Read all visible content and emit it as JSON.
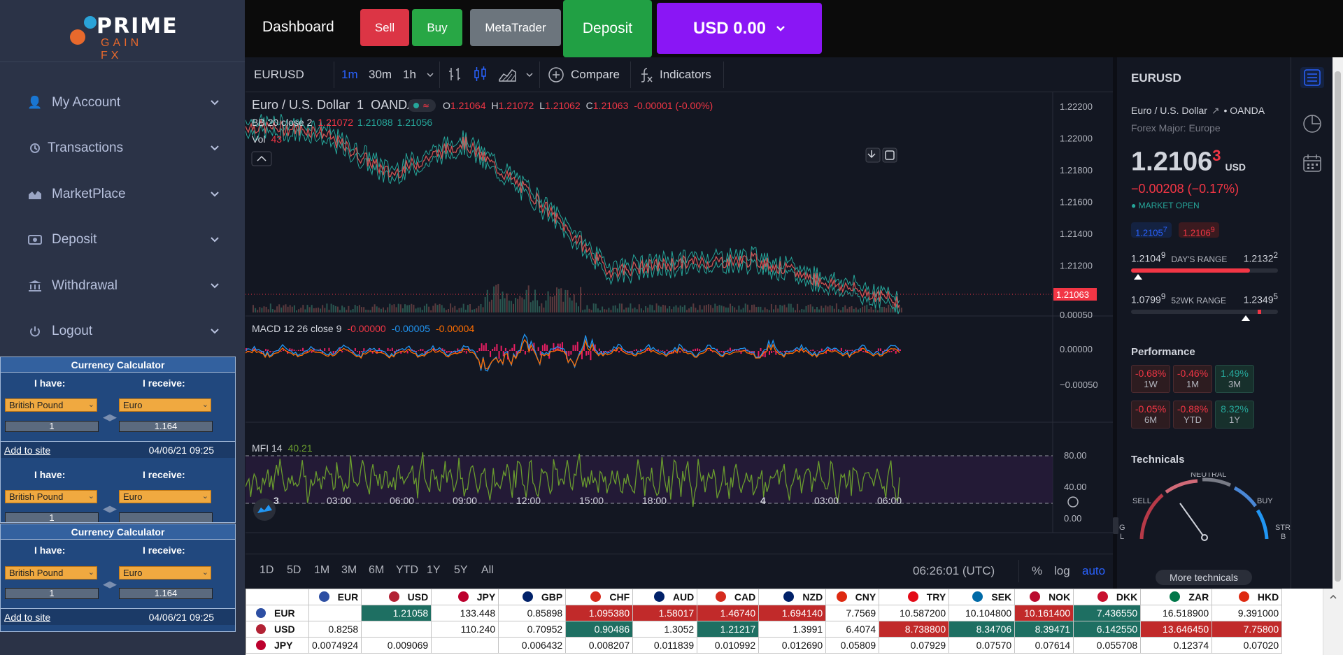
{
  "logo": {
    "line1": "PRIME",
    "line2": "GAIN FX"
  },
  "nav": [
    {
      "label": "My Account",
      "icon": "user-plus-icon"
    },
    {
      "label": "Transactions",
      "icon": "history-icon"
    },
    {
      "label": "MarketPlace",
      "icon": "chart-area-icon"
    },
    {
      "label": "Deposit",
      "icon": "money-bill-icon"
    },
    {
      "label": "Withdrawal",
      "icon": "bank-icon"
    },
    {
      "label": "Logout",
      "icon": "power-icon"
    }
  ],
  "calc": {
    "title": "Currency Calculator",
    "have_label": "I have:",
    "receive_label": "I receive:",
    "from_currency": "British Pound",
    "to_currency": "Euro",
    "amount": "1",
    "result": "1.164",
    "add_link": "Add to site",
    "date": "04/06/21 09:25"
  },
  "topbar": {
    "title": "Dashboard",
    "sell": "Sell",
    "buy": "Buy",
    "metatrader": "MetaTrader",
    "deposit": "Deposit",
    "balance": "USD 0.00"
  },
  "chart": {
    "symbol": "EURUSD",
    "intervals": [
      "1m",
      "30m",
      "1h"
    ],
    "compare": "Compare",
    "indicators": "Indicators",
    "legend_name": "Euro / U.S. Dollar",
    "legend_interval": "1",
    "legend_source": "OANDA",
    "ohlc": {
      "o": "1.21064",
      "h": "1.21072",
      "l": "1.21062",
      "c": "1.21063",
      "chg": "-0.00001 (-0.00%)"
    },
    "bb": {
      "label": "BB 20 close 2",
      "v1": "1.21072",
      "v2": "1.21088",
      "v3": "1.21056"
    },
    "vol": {
      "label": "Vol",
      "value": "43"
    },
    "macd": {
      "label": "MACD 12 26 close 9",
      "v1": "-0.00000",
      "v2": "-0.00005",
      "v3": "-0.00004"
    },
    "mfi": {
      "label": "MFI 14",
      "value": "40.21"
    },
    "price_ticks": [
      "1.22200",
      "1.22000",
      "1.21800",
      "1.21600",
      "1.21400",
      "1.21200",
      "1.21000"
    ],
    "current_price": "1.21063",
    "macd_ticks": [
      "0.00050",
      "0.00000",
      "−0.00050"
    ],
    "mfi_ticks": [
      "80.00",
      "40.00",
      "0.00"
    ],
    "time_ticks": [
      "3",
      "03:00",
      "06:00",
      "09:00",
      "12:00",
      "15:00",
      "18:00",
      "4",
      "03:00",
      "06:00"
    ],
    "ranges": [
      "1D",
      "5D",
      "1M",
      "3M",
      "6M",
      "YTD",
      "1Y",
      "5Y",
      "All"
    ],
    "clock": "06:26:01 (UTC)",
    "pct": "%",
    "log": "log",
    "auto": "auto"
  },
  "chart_data": {
    "type": "line",
    "title": "Euro / U.S. Dollar",
    "x": [
      "3",
      "03:00",
      "06:00",
      "09:00",
      "12:00",
      "15:00",
      "18:00",
      "4",
      "03:00",
      "06:00"
    ],
    "series": [
      {
        "name": "EURUSD",
        "values": [
          1.2215,
          1.2212,
          1.2185,
          1.2205,
          1.217,
          1.2125,
          1.213,
          1.2132,
          1.2118,
          1.21063
        ]
      }
    ],
    "ylim": [
      1.2095,
      1.2225
    ]
  },
  "details": {
    "symbol": "EURUSD",
    "name": "Euro / U.S. Dollar",
    "exchange": "OANDA",
    "category": "Forex Major: Europe",
    "price_main": "1.2106",
    "price_last": "3",
    "currency": "USD",
    "change": "−0.00208 (−0.17%)",
    "status": "MARKET OPEN",
    "bid": "1.2105",
    "bid_sup": "7",
    "ask": "1.2106",
    "ask_sup": "9",
    "day_low": "1.2104",
    "day_low_sup": "9",
    "day_label": "DAY'S RANGE",
    "day_high": "1.2132",
    "day_high_sup": "2",
    "wk_low": "1.0799",
    "wk_low_sup": "9",
    "wk_label": "52WK RANGE",
    "wk_high": "1.2349",
    "wk_high_sup": "5",
    "performance_title": "Performance",
    "performance": [
      {
        "v": "-0.68%",
        "p": "1W",
        "neg": true
      },
      {
        "v": "-0.46%",
        "p": "1M",
        "neg": true
      },
      {
        "v": "1.49%",
        "p": "3M",
        "neg": false
      },
      {
        "v": "-0.05%",
        "p": "6M",
        "neg": true
      },
      {
        "v": "-0.88%",
        "p": "YTD",
        "neg": true
      },
      {
        "v": "8.32%",
        "p": "1Y",
        "neg": false
      }
    ],
    "technicals_title": "Technicals",
    "gauge": {
      "neutral": "NEUTRAL",
      "sell": "SELL",
      "buy": "BUY",
      "left_cut": "IG",
      "left_cut2": "L",
      "right_cut": "STR",
      "right_cut2": "B"
    },
    "more": "More technicals"
  },
  "table": {
    "headers": [
      "EUR",
      "USD",
      "JPY",
      "GBP",
      "CHF",
      "AUD",
      "CAD",
      "NZD",
      "CNY",
      "TRY",
      "SEK",
      "NOK",
      "DKK",
      "ZAR",
      "HKD"
    ],
    "rows": [
      {
        "cur": "EUR",
        "cells": [
          "",
          "1.21058",
          "133.448",
          "0.85898",
          "1.095380",
          "1.58017",
          "1.46740",
          "1.694140",
          "7.7569",
          "10.587200",
          "10.104800",
          "10.161400",
          "7.436550",
          "16.518900",
          "9.391000"
        ],
        "cls": [
          "",
          "g",
          "",
          "",
          "r",
          "r",
          "r",
          "r",
          "",
          "",
          "",
          "r",
          "g",
          "",
          ""
        ]
      },
      {
        "cur": "USD",
        "cells": [
          "0.8258",
          "",
          "110.240",
          "0.70952",
          "0.90486",
          "1.3052",
          "1.21217",
          "1.3991",
          "6.4074",
          "8.738800",
          "8.34706",
          "8.39471",
          "6.142550",
          "13.646450",
          "7.75800"
        ],
        "cls": [
          "",
          "",
          "",
          "",
          "g",
          "",
          "g",
          "",
          "",
          "r",
          "g",
          "g",
          "g",
          "r",
          "r"
        ]
      },
      {
        "cur": "JPY",
        "cells": [
          "0.0074924",
          "0.009069",
          "",
          "0.006432",
          "0.008207",
          "0.011839",
          "0.010992",
          "0.012690",
          "0.05809",
          "0.07929",
          "0.07570",
          "0.07614",
          "0.055708",
          "0.12374",
          "0.07020"
        ],
        "cls": [
          "",
          "",
          "",
          "",
          "",
          "",
          "",
          "",
          "",
          "",
          "",
          "",
          "",
          "",
          ""
        ]
      }
    ]
  },
  "colors": {
    "sell": "#dc3545",
    "buy": "#28a745",
    "deposit": "#21a044",
    "balance": "#8a16f5",
    "accent": "#2962ff",
    "down": "#f23645",
    "up": "#089981"
  }
}
